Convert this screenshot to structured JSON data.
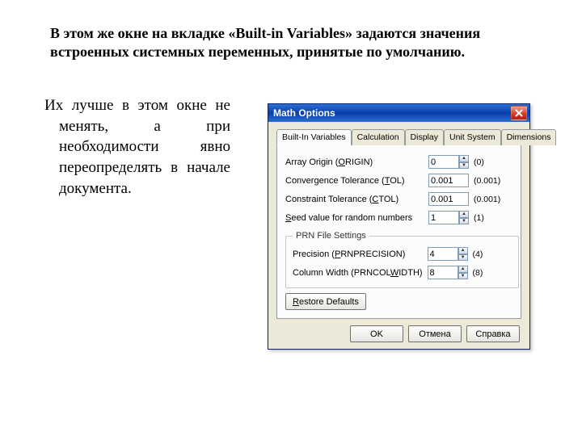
{
  "heading": "В этом же окне на вкладке «Built-in Variables» задаются значения встроенных системных переменных, принятые по умолчанию.",
  "body": "Их лучше в этом окне не менять, а при необходимости явно переопределять в начале документа.",
  "win": {
    "title": "Math Options",
    "tabs": {
      "builtin": "Built-In Variables",
      "calc": "Calculation",
      "display": "Display",
      "units": "Unit System",
      "dim": "Dimensions"
    },
    "rows": {
      "origin": {
        "pre": "Array Origin  (",
        "u": "O",
        "post": "RIGIN)",
        "val": "0",
        "def": "(0)"
      },
      "tol": {
        "pre": "Convergence Tolerance  (",
        "u": "T",
        "post": "OL)",
        "val": "0.001",
        "def": "(0.001)"
      },
      "ctol": {
        "pre": "Constraint Tolerance  (",
        "u": "C",
        "post": "TOL)",
        "val": "0.001",
        "def": "(0.001)"
      },
      "seed_pre": "S",
      "seed_post": "eed value for random numbers",
      "seed_val": "1",
      "seed_def": "(1)",
      "prn_legend": "PRN File Settings",
      "prec": {
        "pre": "Precision  (",
        "u": "P",
        "post": "RNPRECISION)",
        "val": "4",
        "def": "(4)"
      },
      "cw_pre": "Column Width  (PRNCOL",
      "cw_u": "W",
      "cw_post": "IDTH)",
      "cw_val": "8",
      "cw_def": "(8)"
    },
    "restore_u": "R",
    "restore_post": "estore Defaults",
    "ok": "OK",
    "cancel": "Отмена",
    "help": "Справка"
  }
}
